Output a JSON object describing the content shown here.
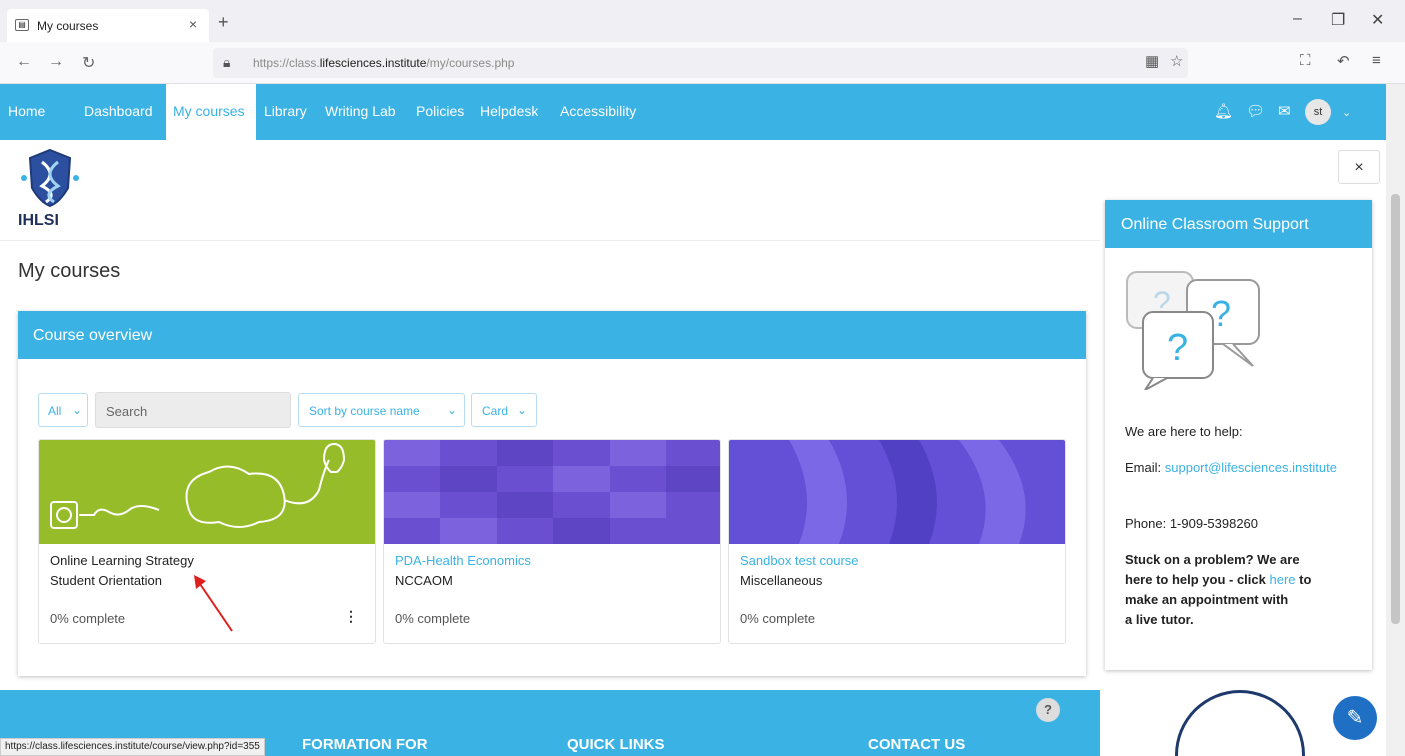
{
  "browser": {
    "tab_title": "My courses",
    "tab_close": "×",
    "new_tab": "+",
    "url_prefix": "https://class.",
    "url_domain": "lifesciences.institute",
    "url_path": "/my/courses.php",
    "status_url": "https://class.lifesciences.institute/course/view.php?id=355"
  },
  "navbar": {
    "items": [
      "Home",
      "Dashboard",
      "My courses",
      "Library",
      "Writing Lab",
      "Policies",
      "Helpdesk",
      "Accessibility"
    ],
    "avatar": "st"
  },
  "logo": {
    "text": "IHLSI"
  },
  "page": {
    "title": "My courses"
  },
  "overview": {
    "header": "Course overview",
    "filter": "All",
    "search_placeholder": "Search",
    "sort": "Sort by course name",
    "view": "Card",
    "courses": [
      {
        "name": "Online Learning Strategy",
        "category": "Student Orientation",
        "progress": "0% complete",
        "name_color": "#222222"
      },
      {
        "name": "PDA-Health Economics",
        "category": "NCCAOM",
        "progress": "0% complete",
        "name_color": "#3ab2e3"
      },
      {
        "name": "Sandbox test course",
        "category": "Miscellaneous",
        "progress": "0% complete",
        "name_color": "#3ab2e3"
      }
    ]
  },
  "support": {
    "close": "×",
    "header": "Online Classroom Support",
    "intro": "We are here to help:",
    "email_label": "Email:",
    "email": "support@lifesciences.institute",
    "phone": "Phone: 1-909-5398260",
    "stuck_1": "Stuck on a problem? We are",
    "stuck_2": "here to help you - click",
    "here": "here",
    "stuck_3": "to",
    "stuck_4": "make an appointment with",
    "stuck_5": "a live tutor."
  },
  "footer": {
    "col1": "FORMATION FOR",
    "col2": "QUICK LINKS",
    "col3": "CONTACT US",
    "help": "?"
  },
  "colors": {
    "accent": "#3ab2e3"
  }
}
